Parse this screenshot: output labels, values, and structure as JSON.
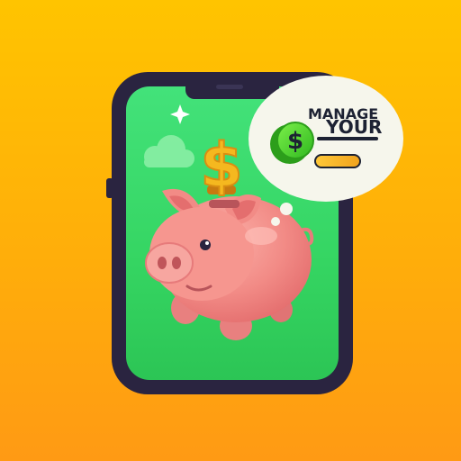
{
  "speech_bubble": {
    "line1": "MANAGE",
    "line2": "YOUR",
    "coin_symbol": "$"
  },
  "floating_coin": {
    "symbol": "$"
  },
  "icons": {
    "phone": "smartphone-icon",
    "pig": "piggy-bank-icon",
    "coin": "dollar-coin-icon",
    "cloud": "cloud-icon",
    "sparkle": "sparkle-icon"
  },
  "colors": {
    "background": "#FFB000",
    "phone_frame": "#2a2440",
    "screen": "#3BDD6B",
    "pig": "#F28B8B",
    "dollar": "#F5B81F",
    "bubble_coin": "#4CD22E"
  }
}
